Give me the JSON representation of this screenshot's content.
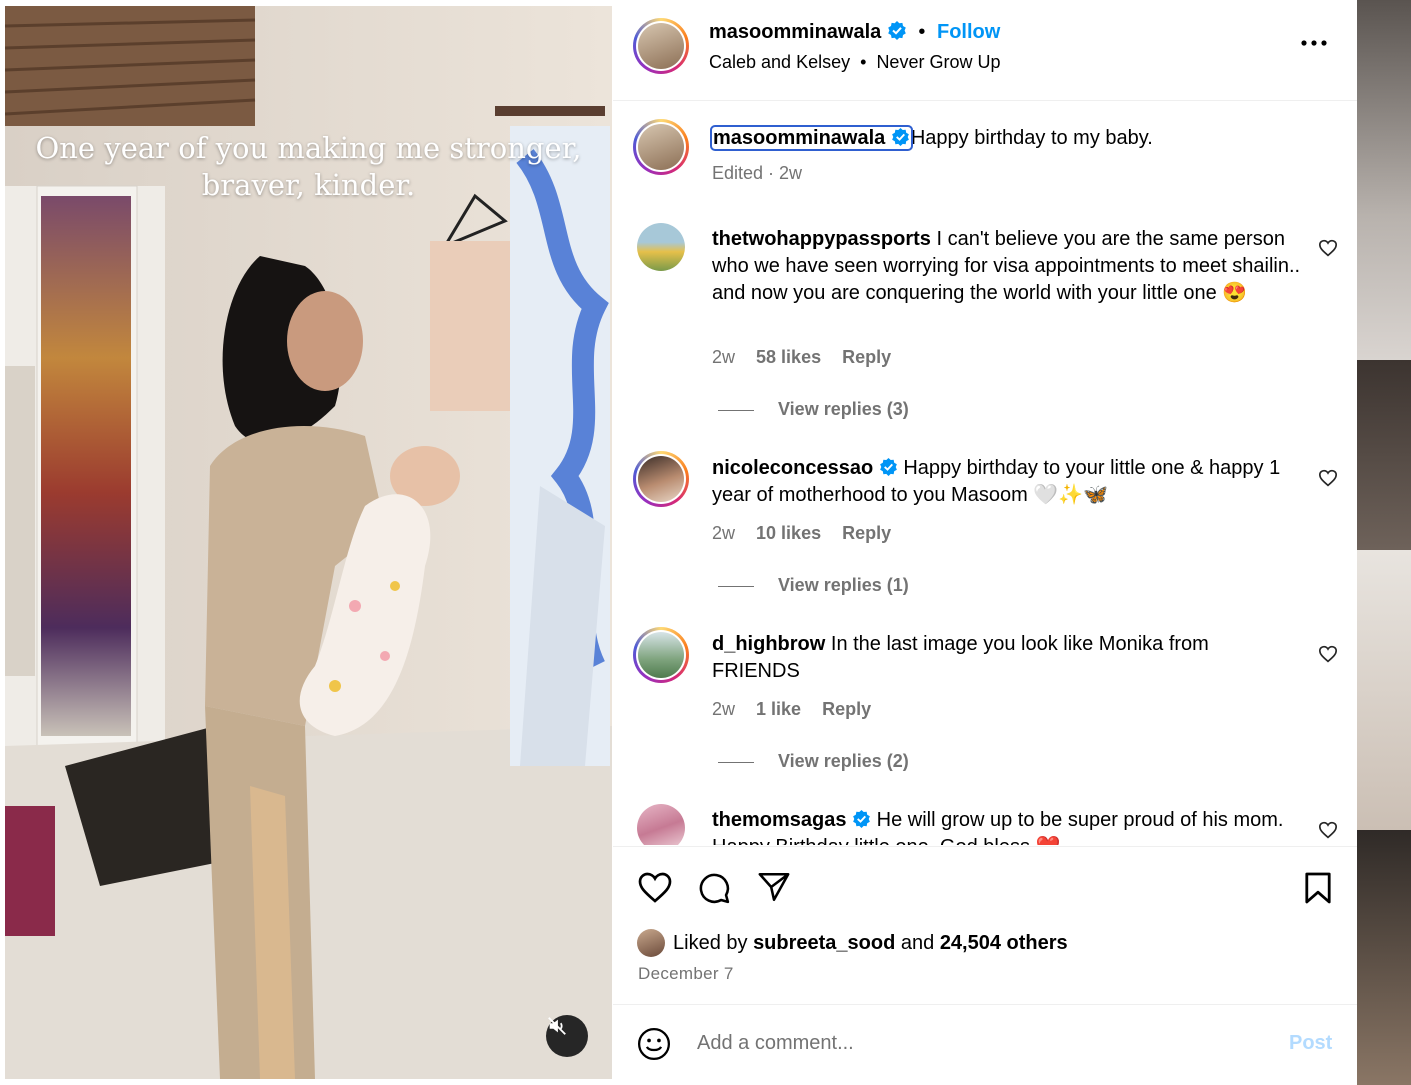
{
  "media": {
    "overlay_line1": "One year of you making me stronger,",
    "overlay_line2": "braver, kinder.",
    "mute_icon": "speaker-muted-icon"
  },
  "header": {
    "username": "masoomminawala",
    "follow_label": "Follow",
    "separator": "•",
    "audio_artist": "Caleb and Kelsey",
    "audio_sep": "•",
    "audio_title": "Never Grow Up",
    "more_icon": "more-horizontal-icon"
  },
  "caption": {
    "username": "masoomminawala",
    "text": "Happy birthday to my baby.",
    "meta": "Edited · 2w"
  },
  "comments": [
    {
      "username": "thetwohappypassports",
      "text": "I can't believe you are the same person who we have seen worrying for visa appointments to meet shailin.. and now you are conquering the world with your little one 😍",
      "time": "2w",
      "likes": "58 likes",
      "reply": "Reply",
      "view_replies": "View replies (3)"
    },
    {
      "username": "nicoleconcessao",
      "text": "Happy birthday to your little one & happy 1 year of motherhood to you Masoom 🤍✨🦋",
      "time": "2w",
      "likes": "10 likes",
      "reply": "Reply",
      "view_replies": "View replies (1)"
    },
    {
      "username": "d_highbrow",
      "text": "In the last image you look like Monika from FRIENDS",
      "time": "2w",
      "likes": "1 like",
      "reply": "Reply",
      "view_replies": "View replies (2)"
    },
    {
      "username": "themomsagas",
      "text": "He will grow up to be super proud of his mom. Happy Birthday little one. God bless ❤️"
    }
  ],
  "actions": {
    "liked_prefix": "Liked by ",
    "liked_user": "subreeta_sood",
    "liked_mid": " and ",
    "liked_count": "24,504 others",
    "date": "December 7"
  },
  "add_comment": {
    "placeholder": "Add a comment...",
    "post_label": "Post"
  },
  "colors": {
    "accent": "#0095f6",
    "verified": "#0095f6",
    "muted_text": "#737373",
    "post_disabled": "#b3dbff"
  }
}
